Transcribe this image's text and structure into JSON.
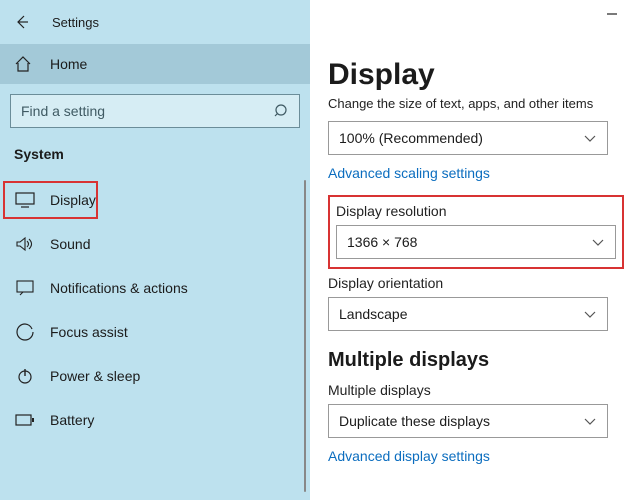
{
  "window": {
    "title": "Settings"
  },
  "sidebar": {
    "home": "Home",
    "search_placeholder": "Find a setting",
    "group": "System",
    "items": [
      {
        "label": "Display"
      },
      {
        "label": "Sound"
      },
      {
        "label": "Notifications & actions"
      },
      {
        "label": "Focus assist"
      },
      {
        "label": "Power & sleep"
      },
      {
        "label": "Battery"
      }
    ]
  },
  "main": {
    "heading": "Display",
    "scale": {
      "label": "Change the size of text, apps, and other items",
      "value": "100% (Recommended)",
      "link": "Advanced scaling settings"
    },
    "resolution": {
      "label": "Display resolution",
      "value": "1366 × 768"
    },
    "orientation": {
      "label": "Display orientation",
      "value": "Landscape"
    },
    "multiple": {
      "heading": "Multiple displays",
      "label": "Multiple displays",
      "value": "Duplicate these displays",
      "link": "Advanced display settings"
    }
  }
}
